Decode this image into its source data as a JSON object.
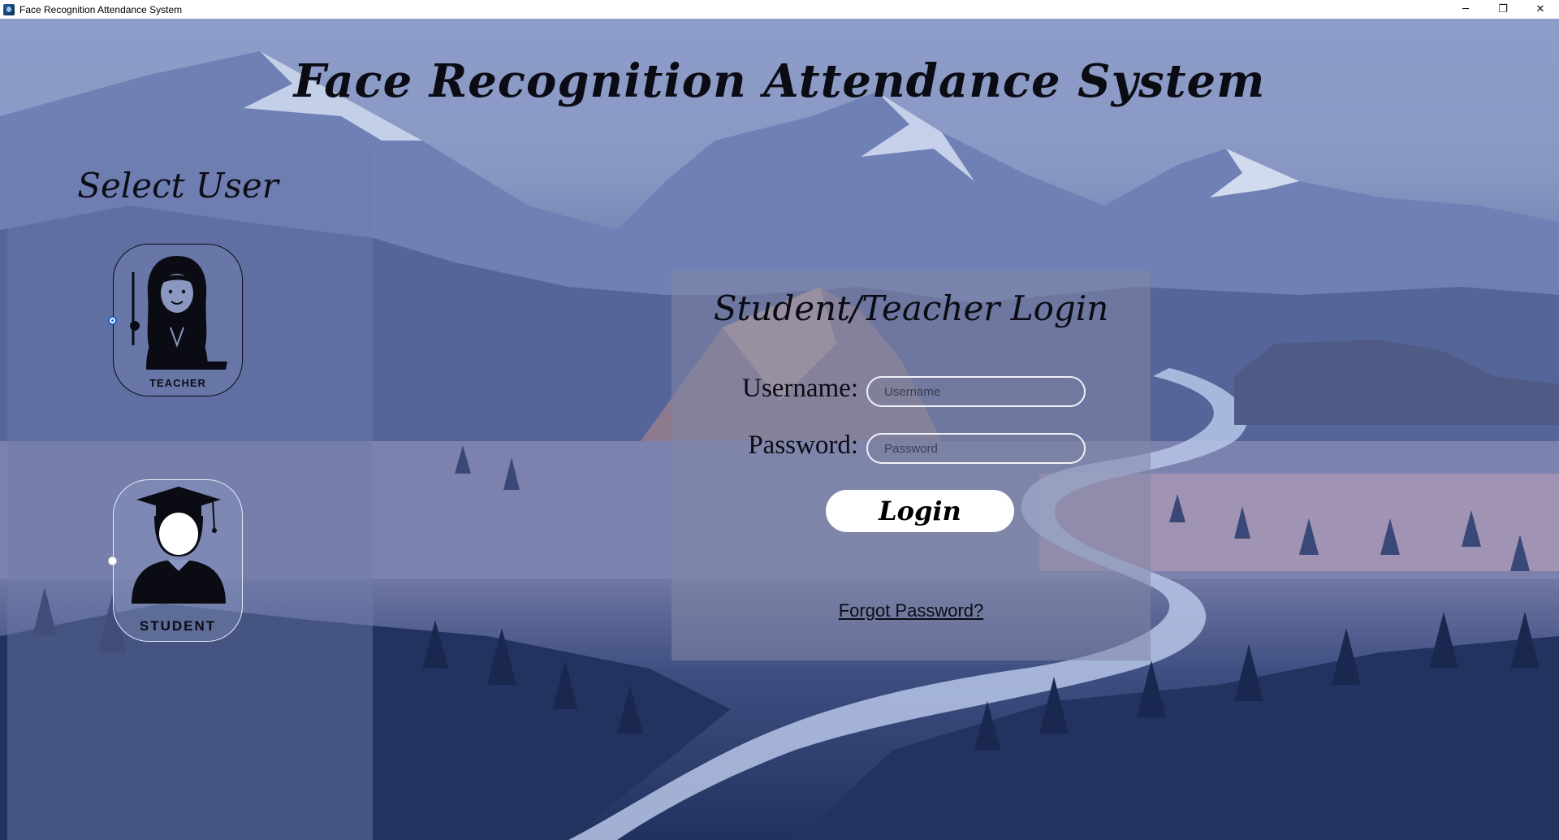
{
  "window": {
    "title": "Face Recognition Attendance System",
    "minimize_glyph": "─",
    "restore_glyph": "❐",
    "close_glyph": "✕"
  },
  "header": {
    "title": "Face Recognition Attendance System"
  },
  "user_panel": {
    "title": "Select User",
    "options": [
      {
        "label": "TEACHER",
        "icon": "teacher-avatar-icon",
        "selected": true
      },
      {
        "label": "STUDENT",
        "icon": "student-graduate-icon",
        "selected": false
      }
    ]
  },
  "login": {
    "title": "Student/Teacher Login",
    "username_label": "Username:",
    "username_placeholder": "Username",
    "username_value": "",
    "password_label": "Password:",
    "password_placeholder": "Password",
    "password_value": "",
    "login_button": "Login",
    "forgot_link": "Forgot Password?"
  },
  "colors": {
    "accent_radio": "#1a5fd0",
    "button_bg": "#ffffff",
    "text": "#0b0b14"
  }
}
